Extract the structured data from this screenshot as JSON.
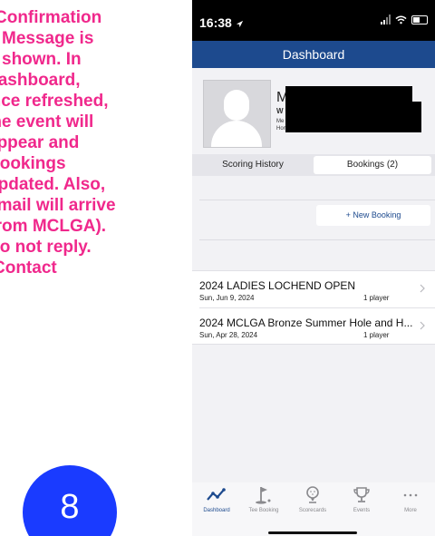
{
  "instructions": {
    "lines": [
      "Confirmation",
      "Message is",
      "shown. In",
      "Dashboard,",
      "once refreshed,",
      "the event will",
      "appear and",
      "Bookings",
      "updated. Also,",
      "email will arrive",
      "(from MCLGA).",
      "Do not reply.",
      "Contact"
    ],
    "step": "8"
  },
  "status_bar": {
    "time": "16:38"
  },
  "nav": {
    "title": "Dashboard"
  },
  "profile": {
    "name_initial": "M",
    "line1": "W",
    "line2": "Me",
    "line3": "Hom"
  },
  "segments": {
    "left": "Scoring History",
    "right": "Bookings (2)"
  },
  "new_booking_label": "+ New Booking",
  "bookings": [
    {
      "title": "2024 LADIES LOCHEND OPEN",
      "date": "Sun, Jun 9, 2024",
      "players": "1 player"
    },
    {
      "title": "2024 MCLGA Bronze Summer Hole and H...",
      "date": "Sun, Apr 28, 2024",
      "players": "1 player"
    }
  ],
  "tabs": [
    {
      "label": "Dashboard",
      "icon": "dashboard-line-icon"
    },
    {
      "label": "Tee Booking",
      "icon": "golf-flag-icon"
    },
    {
      "label": "Scorecards",
      "icon": "golf-ball-icon"
    },
    {
      "label": "Events",
      "icon": "trophy-icon"
    },
    {
      "label": "More",
      "icon": "ellipsis-icon"
    }
  ],
  "colors": {
    "brand": "#1d4a8e",
    "highlight": "#f0288c",
    "badge": "#1a3bff"
  }
}
